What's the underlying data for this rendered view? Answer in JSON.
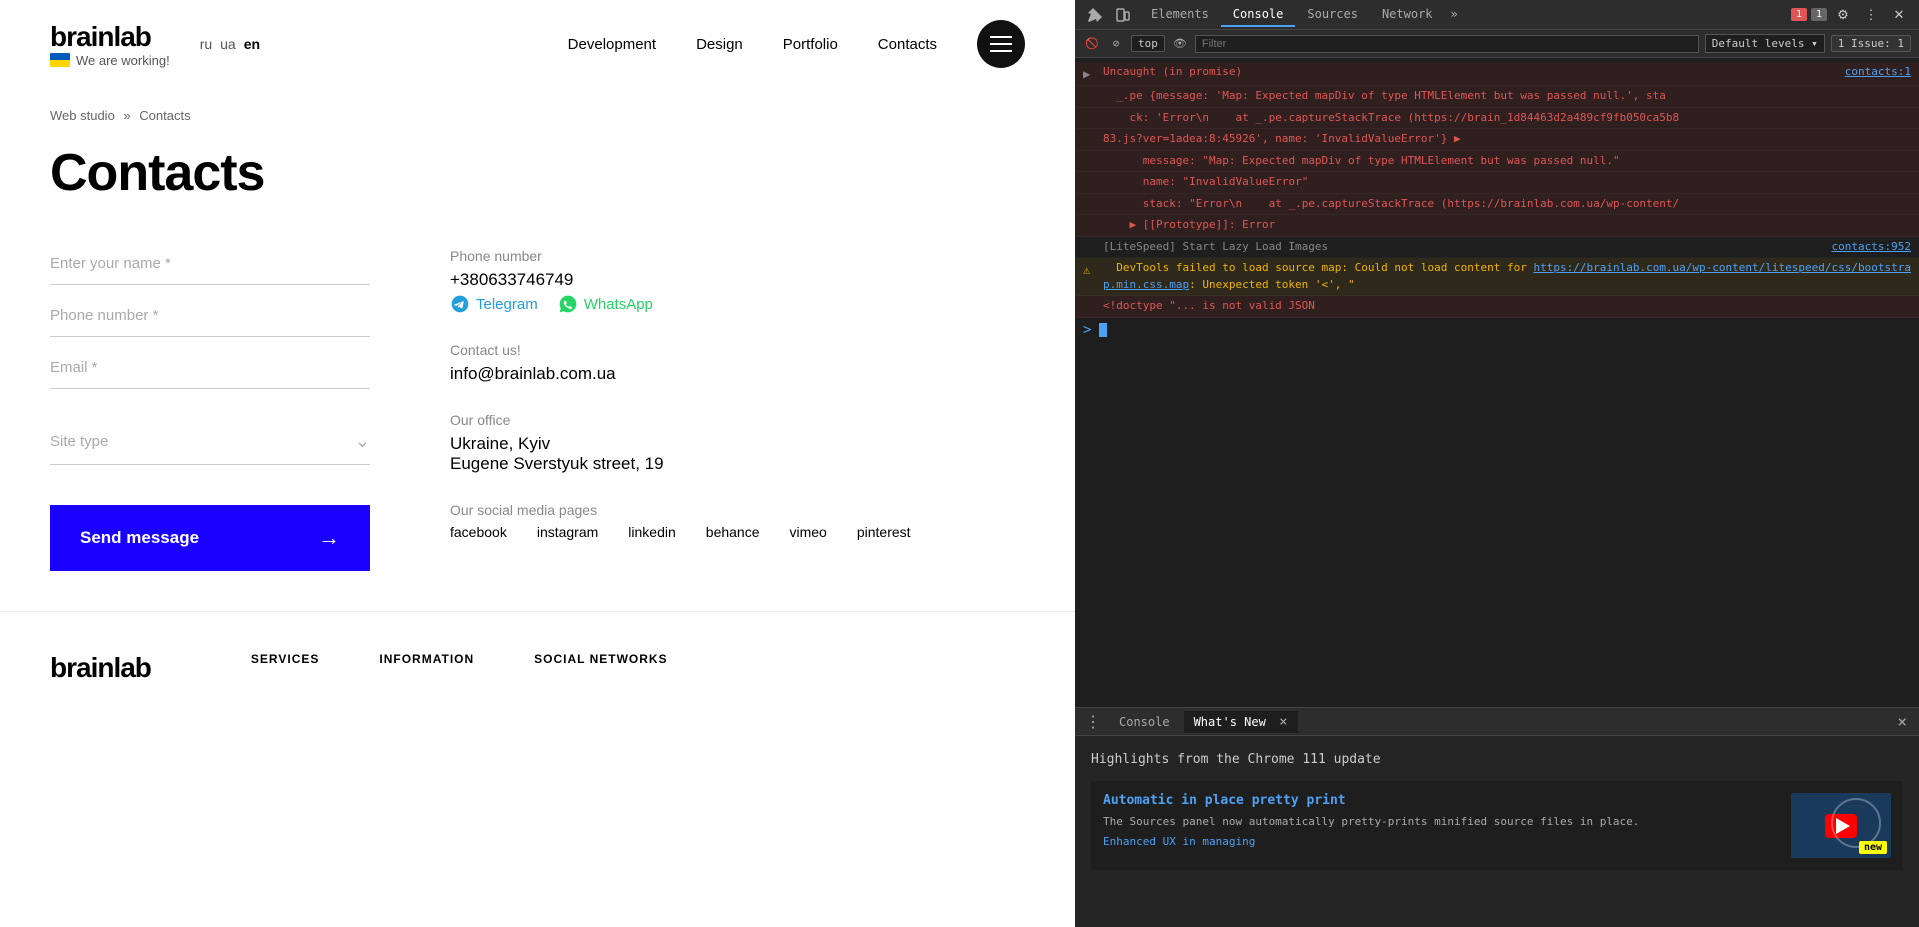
{
  "website": {
    "header": {
      "logo": "brainlab",
      "tagline": "We are working!",
      "languages": [
        "ru",
        "ua",
        "en"
      ],
      "active_lang": "en",
      "nav_items": [
        "Development",
        "Design",
        "Portfolio",
        "Contacts"
      ]
    },
    "breadcrumb": {
      "items": [
        "Web studio",
        "Contacts"
      ],
      "separator": "»"
    },
    "page_title": "Contacts",
    "form": {
      "name_placeholder": "Enter your name *",
      "phone_placeholder": "Phone number *",
      "email_placeholder": "Email *",
      "site_type_label": "Site type",
      "send_button": "Send message"
    },
    "contact_info": {
      "phone_label": "Phone number",
      "phone_value": "+380633746749",
      "telegram_label": "Telegram",
      "whatsapp_label": "WhatsApp",
      "contact_us_label": "Contact us!",
      "email_value": "info@brainlab.com.ua",
      "office_label": "Our office",
      "location": "Ukraine, Kyiv",
      "address": "Eugene Sverstyuk street, 19",
      "social_label": "Our social media pages",
      "social_links": [
        "facebook",
        "instagram",
        "linkedin",
        "behance",
        "vimeo",
        "pinterest"
      ]
    },
    "footer": {
      "logo": "brainlab",
      "services_heading": "SERVICES",
      "information_heading": "INFORMATION",
      "social_heading": "SOCIAL NETWORKS"
    }
  },
  "devtools": {
    "toolbar": {
      "icons": [
        "inspect",
        "device",
        "elements",
        "console",
        "sources",
        "network",
        "more"
      ],
      "tabs": [
        "Elements",
        "Console",
        "Sources",
        "Network"
      ],
      "active_tab": "Console",
      "more_tabs": "»",
      "error_count": "1",
      "warning_count": "1"
    },
    "secondary_bar": {
      "top_label": "top",
      "filter_placeholder": "Filter",
      "level_label": "Default levels",
      "issue_label": "1 Issue: 1"
    },
    "console_lines": [
      {
        "type": "error",
        "expand": true,
        "text": "Uncaught (in promise)",
        "source": "contacts:1"
      },
      {
        "type": "error",
        "expand": false,
        "text": "  _.pe {message: 'Map: Expected mapDiv of type HTMLElement but was passed null.', sta",
        "source": ""
      },
      {
        "type": "error",
        "expand": false,
        "text": "    ck: 'Error\\n    at _.pe.captureStackTrace (https://brain_1d84463d2a489cf9fb050ca5b8",
        "source": ""
      },
      {
        "type": "error",
        "expand": false,
        "text": "83.js?ver=1adea:8:45926', name: 'InvalidValueError'} ▶",
        "source": ""
      },
      {
        "type": "error",
        "expand": false,
        "text": "      message: \"Map: Expected mapDiv of type HTMLElement but was passed null.\"",
        "source": ""
      },
      {
        "type": "error",
        "expand": false,
        "text": "      name: \"InvalidValueError\"",
        "source": ""
      },
      {
        "type": "error",
        "expand": false,
        "text": "      stack: \"Error\\n    at _.pe.captureStackTrace (https://brainlab.com.ua/wp-content/",
        "source": ""
      },
      {
        "type": "error",
        "expand": false,
        "text": "    ▶ [[Prototype]]: Error",
        "source": ""
      },
      {
        "type": "info",
        "expand": false,
        "text": "[LiteSpeed] Start Lazy Load Images",
        "source": "contacts:952"
      },
      {
        "type": "warning",
        "expand": false,
        "text": "  DevTools failed to load source map: Could not load content for ",
        "link": "https://brainlab.com.ua/wp-content/litespeed/css/bootstrap.min.css.map",
        "link_text": "https://brainlab.com.ua/wp-content/litespeed/css/bootstrap.min.css.map",
        "after_link": ": Unexpected token '<', \"",
        "source": ""
      },
      {
        "type": "error",
        "expand": false,
        "text": "<!doctype \"... is not valid JSON",
        "source": ""
      }
    ],
    "bottom_panel": {
      "tabs": [
        "Console",
        "What's New"
      ],
      "active_tab": "What's New",
      "close_label": "×",
      "whats_new_title": "Highlights from the Chrome 111 update",
      "card_title": "Automatic in place pretty print",
      "card_desc": "The Sources panel now automatically pretty-prints minified source files in place.",
      "card_more": "Enhanced UX in managing"
    }
  }
}
